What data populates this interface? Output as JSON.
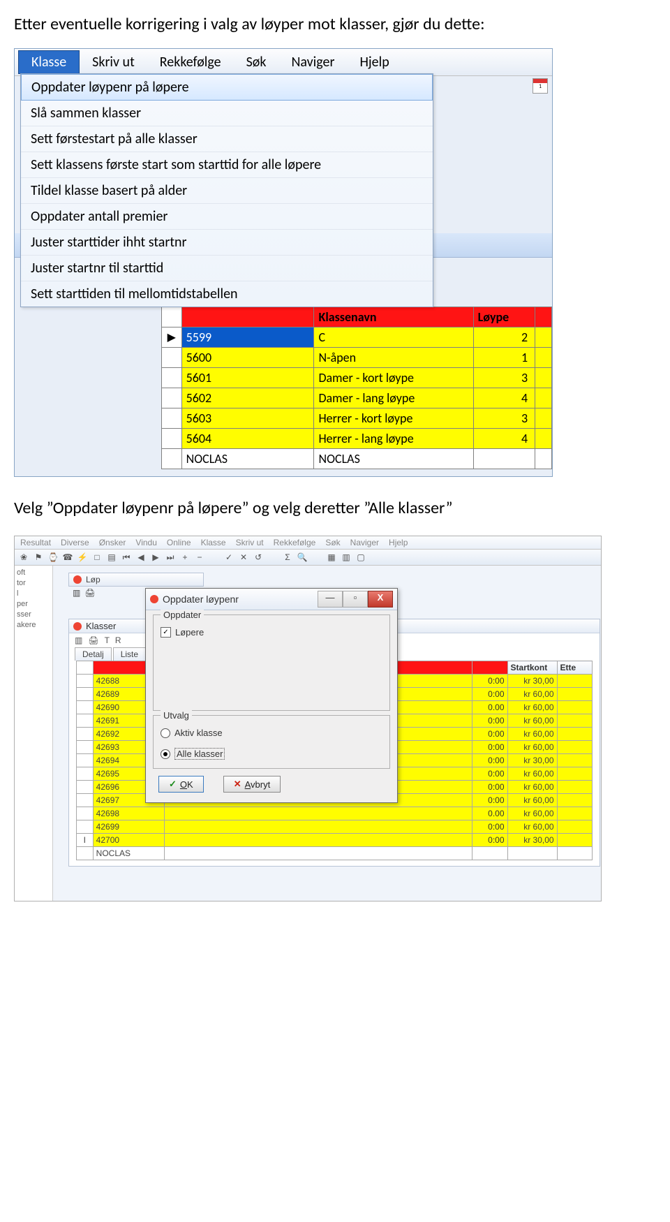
{
  "heading_top": "Etter eventuelle korrigering i valg av løyper mot klasser, gjør du dette:",
  "heading_mid_a": "Velg ",
  "heading_mid_b": "Oppdater løypenr på løpere",
  "heading_mid_c": " og velg deretter ",
  "heading_mid_d": "Alle klasser",
  "screenshot1": {
    "menubar": [
      "Klasse",
      "Skriv ut",
      "Rekkefølge",
      "Søk",
      "Naviger",
      "Hjelp"
    ],
    "dropdown": [
      "Oppdater løypenr på løpere",
      "Slå sammen klasser",
      "Sett førstestart på alle klasser",
      "Sett klassens første start som starttid for alle løpere",
      "Tildel klasse basert på alder",
      "Oppdater antall premier",
      "Juster starttider  ihht startnr",
      "Juster startnr til starttid",
      "Sett starttiden til mellomtidstabellen"
    ],
    "table": {
      "headers": [
        "",
        "Klassenavn",
        "Løype",
        ""
      ],
      "rows": [
        {
          "sel": "▶",
          "id": "5599",
          "name": "C",
          "loype": "2",
          "yellow": true,
          "selected": true
        },
        {
          "sel": "",
          "id": "5600",
          "name": "N-åpen",
          "loype": "1",
          "yellow": true
        },
        {
          "sel": "",
          "id": "5601",
          "name": "Damer - kort løype",
          "loype": "3",
          "yellow": true
        },
        {
          "sel": "",
          "id": "5602",
          "name": "Damer - lang løype",
          "loype": "4",
          "yellow": true
        },
        {
          "sel": "",
          "id": "5603",
          "name": "Herrer - kort løype",
          "loype": "3",
          "yellow": true
        },
        {
          "sel": "",
          "id": "5604",
          "name": "Herrer - lang løype",
          "loype": "4",
          "yellow": true
        },
        {
          "sel": "",
          "id": "NOCLAS",
          "name": "NOCLAS",
          "loype": "",
          "yellow": false
        }
      ]
    }
  },
  "screenshot2": {
    "menubar": [
      "Resultat",
      "Diverse",
      "Ønsker",
      "Vindu",
      "Online",
      "Klasse",
      "Skriv ut",
      "Rekkefølge",
      "Søk",
      "Naviger",
      "Hjelp"
    ],
    "toolbar_icons": [
      "❀",
      "⚑",
      "⌚",
      "☎",
      "⚡",
      "□",
      "▤",
      "⏮",
      "◀",
      "▶",
      "⏭",
      "+",
      "−",
      "",
      "✓",
      "✕",
      "↺",
      "",
      "Σ",
      "🔍",
      "",
      "▦",
      "▥",
      "▢"
    ],
    "sidebar_lines": [
      "oft",
      "tor",
      "l",
      "per",
      "sser",
      "akere"
    ],
    "lop_title": "Løp",
    "klasser_title": "Klasser",
    "mini_toolbar": [
      "▥",
      "🖨",
      "T",
      "R"
    ],
    "tabs": [
      "Detalj",
      "Liste"
    ],
    "lop_icons": [
      "▥",
      "🖨"
    ],
    "table": {
      "headers_red": "",
      "headers_white": [
        "Startkont",
        "Ette"
      ],
      "rows": [
        {
          "id": "42688",
          "time": "0:00",
          "kr": "kr 30,00"
        },
        {
          "id": "42689",
          "time": "0:00",
          "kr": "kr 60,00"
        },
        {
          "id": "42690",
          "time": "0.00",
          "kr": "kr 60,00"
        },
        {
          "id": "42691",
          "time": "0:00",
          "kr": "kr 60,00"
        },
        {
          "id": "42692",
          "time": "0:00",
          "kr": "kr 60,00"
        },
        {
          "id": "42693",
          "time": "0:00",
          "kr": "kr 60,00"
        },
        {
          "id": "42694",
          "time": "0:00",
          "kr": "kr 30,00"
        },
        {
          "id": "42695",
          "time": "0:00",
          "kr": "kr 60,00"
        },
        {
          "id": "42696",
          "time": "0:00",
          "kr": "kr 60,00"
        },
        {
          "id": "42697",
          "time": "0:00",
          "kr": "kr 60,00"
        },
        {
          "id": "42698",
          "time": "0.00",
          "kr": "kr 60,00"
        },
        {
          "id": "42699",
          "time": "0:00",
          "kr": "kr 60,00"
        },
        {
          "id": "42700",
          "time": "0:00",
          "kr": "kr 30,00",
          "sel": "I"
        },
        {
          "id": "NOCLAS",
          "time": "",
          "kr": "",
          "white": true
        }
      ]
    },
    "dialog": {
      "title": "Oppdater løypenr",
      "fieldset_oppdater_legend": "Oppdater",
      "checkbox_lopere": "Løpere",
      "fieldset_utvalg_legend": "Utvalg",
      "radio_aktiv": "Aktiv klasse",
      "radio_alle": "Alle klasser",
      "btn_ok": "OK",
      "btn_cancel": "Avbryt"
    }
  }
}
